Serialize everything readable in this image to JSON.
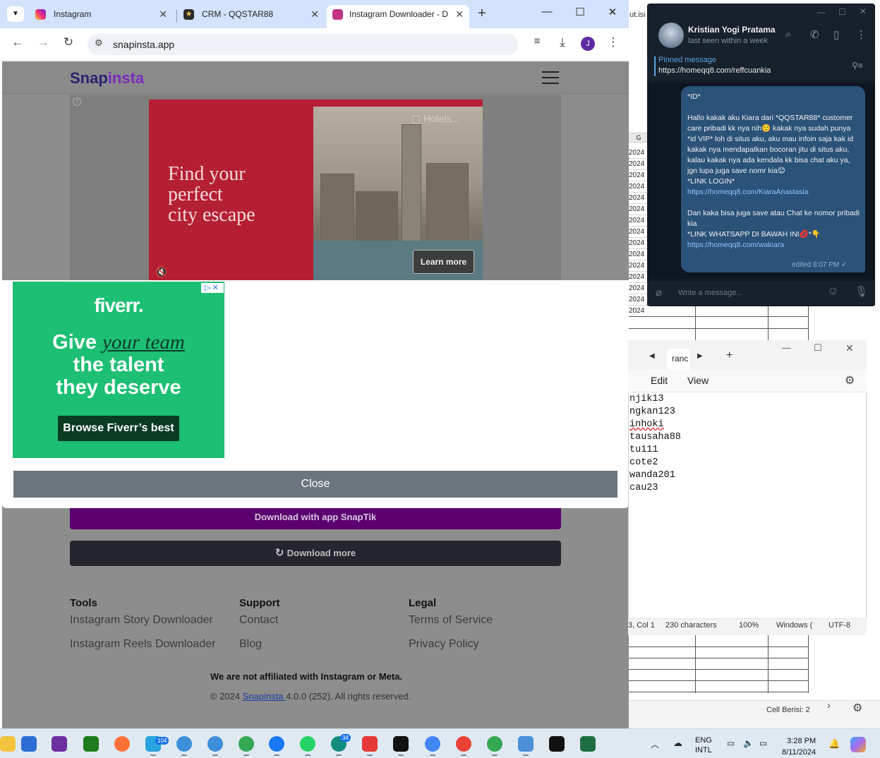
{
  "chrome": {
    "tabs": [
      {
        "title": "Instagram",
        "color": "#d6249f"
      },
      {
        "title": "CRM - QQSTAR88",
        "color": "#3a3a3a"
      },
      {
        "title": "Instagram Downloader - D",
        "color": "#c13584"
      }
    ],
    "url": "snapinsta.app",
    "profile_initial": "J"
  },
  "site": {
    "logo_a": "Snap",
    "logo_b": "insta",
    "ad": {
      "headline": "Find your\nperfect\ncity escape",
      "brand": "Hotels",
      "cta": "Learn more"
    },
    "fiverr": {
      "logo": "fiverr.",
      "line1_a": "Give ",
      "line1_em": "your team",
      "line2": "the talent",
      "line3": "they deserve",
      "cta": "Browse Fiverr’s best"
    },
    "close_label": "Close",
    "download_snaptik": "Download with app SnapTik",
    "download_more": "Download more",
    "footer": {
      "tools_head": "Tools",
      "tools": [
        "Instagram Story Downloader",
        "Instagram Reels Downloader"
      ],
      "support_head": "Support",
      "support": [
        "Contact",
        "Blog"
      ],
      "legal_head": "Legal",
      "legal": [
        "Terms of Service",
        "Privacy Policy"
      ],
      "disclaimer": "We are not affiliated with Instagram or Meta.",
      "copy_prefix": "© 2024 ",
      "copy_link": "Snapinsta ",
      "copy_suffix": "4.0.0 (252). All rights reserved."
    }
  },
  "excel": {
    "tab_fragment": "ut.isi",
    "col_g": "G",
    "row_prefix": "2024",
    "rows": 15,
    "status": "Cell Berisi: 2"
  },
  "telegram": {
    "name": "Kristian Yogi Pratama",
    "status": "last seen within a week",
    "pinned_label": "Pinned message",
    "pinned_url": "https://homeqq8.com/reffcuankia",
    "msg_p1": "*ID*\n\nHallo kakak aku Kiara dari *QQSTAR88* customer care pribadi kk nya nih☺️ kakak nya sudah punya *id VIP* loh di situs aku, aku mau infoin saja kak id kakak nya mendapatkan bocoran jitu di situs aku, kalau kakak nya ada kendala kk bisa chat aku ya, jgn lupa juga save nomr kia😊\n*LINK LOGIN*\n",
    "msg_link1": "https://homeqq8.com/KiaraAnastasia",
    "msg_p2": "\n\nDan kaka bisa juga save atau Chat ke nomor pribadi kia\n*LINK WHATSAPP DI BAWAH INI💋*👇\n",
    "msg_link2": "https://homeqq8.com/wakiara",
    "time": "edited 8:07 PM ✓",
    "input_placeholder": "Write a message..."
  },
  "notepad": {
    "tab": "ranc",
    "menu_edit": "Edit",
    "menu_view": "View",
    "lines": [
      "njik13",
      "ngkan123",
      "inhoki",
      "tausaha88",
      "tu111",
      "cote2",
      "wanda201",
      "cau23"
    ],
    "status_pos": "3, Col 1",
    "status_chars": "230 characters",
    "status_zoom": "100%",
    "status_eol": "Windows (",
    "status_enc": "UTF-8"
  },
  "taskbar": {
    "telegram_badge": "104",
    "whatsapp_badge": "34",
    "lang1": "ENG",
    "lang2": "INTL",
    "time": "3:28 PM",
    "date": "8/11/2024"
  }
}
